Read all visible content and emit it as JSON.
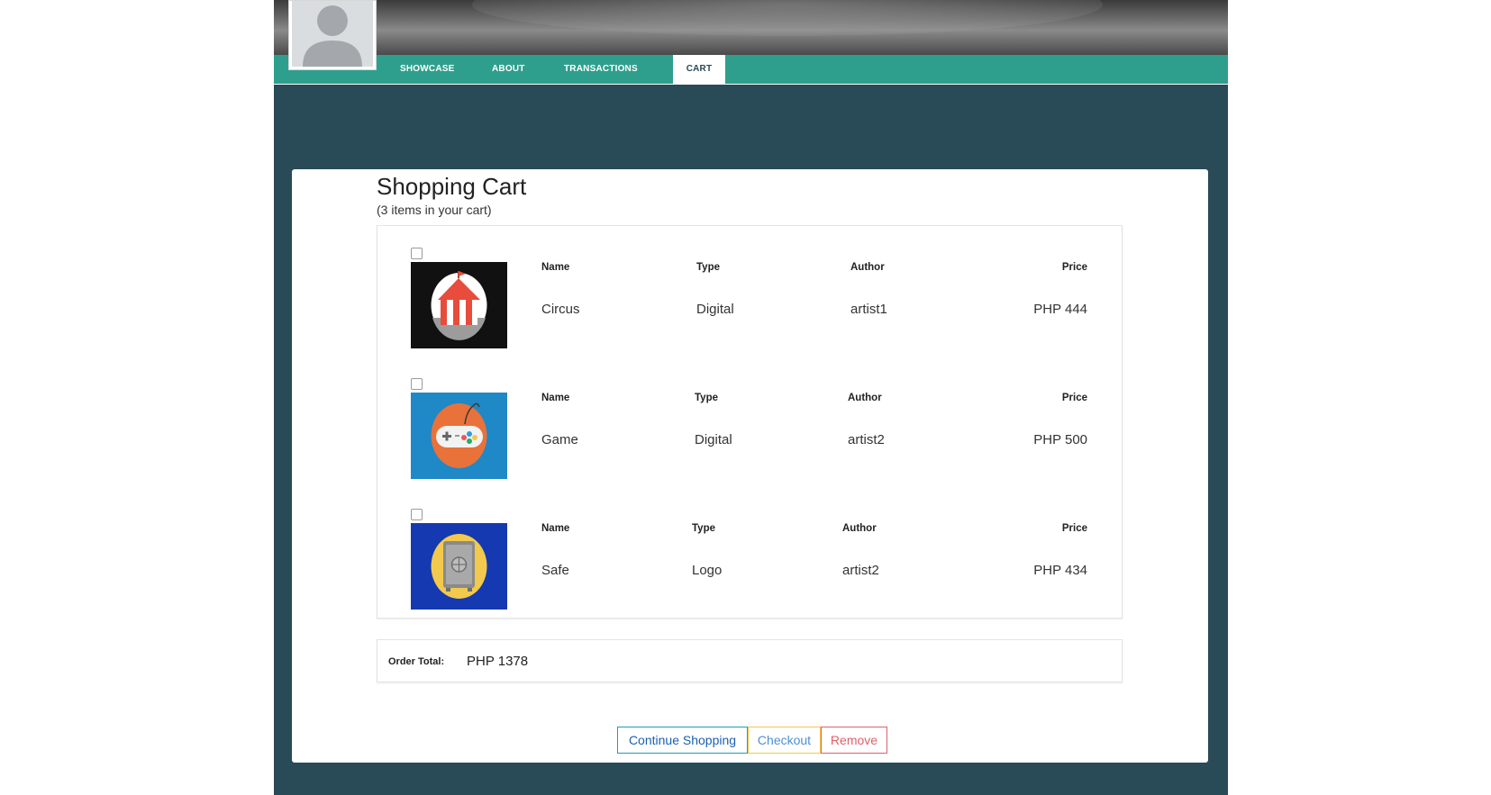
{
  "nav": {
    "tabs": [
      {
        "label": "SHOWCASE"
      },
      {
        "label": "ABOUT"
      },
      {
        "label": "TRANSACTIONS"
      },
      {
        "label": "CART"
      }
    ],
    "active_tab": "CART"
  },
  "cart": {
    "title": "Shopping Cart",
    "subtitle": "(3 items in your cart)",
    "col_labels": {
      "name": "Name",
      "type": "Type",
      "author": "Author",
      "price": "Price"
    },
    "items": [
      {
        "name": "Circus",
        "type": "Digital",
        "author": "artist1",
        "price": "PHP 444",
        "thumb_icon": "circus-tent-icon",
        "thumb_bg": "#111111",
        "checked": false
      },
      {
        "name": "Game",
        "type": "Digital",
        "author": "artist2",
        "price": "PHP 500",
        "thumb_icon": "game-controller-icon",
        "thumb_bg": "#1f88c6",
        "checked": false
      },
      {
        "name": "Safe",
        "type": "Logo",
        "author": "artist2",
        "price": "PHP 434",
        "thumb_icon": "safe-icon",
        "thumb_bg": "#1539b0",
        "checked": false
      }
    ],
    "order_total_label": "Order Total:",
    "order_total_value": "PHP 1378"
  },
  "buttons": {
    "continue_label": "Continue Shopping",
    "checkout_label": "Checkout",
    "remove_label": "Remove"
  },
  "colors": {
    "nav": "#2e9f8d",
    "background": "#294a57",
    "continue_border": "#17a2b8",
    "checkout_border": "#f2c94c",
    "remove_border": "#e0606a"
  }
}
